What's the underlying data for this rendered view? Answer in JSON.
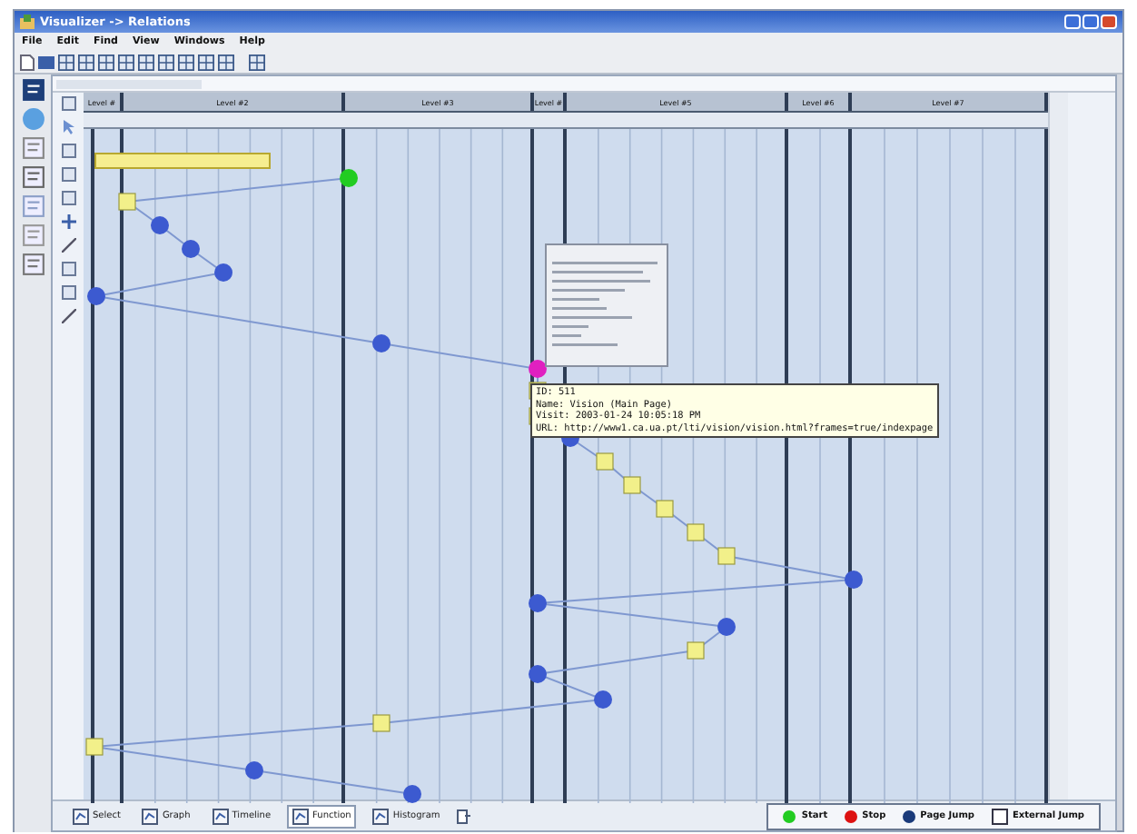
{
  "window": {
    "title": "Visualizer -> Relations"
  },
  "menu": [
    "File",
    "Edit",
    "Find",
    "View",
    "Windows",
    "Help"
  ],
  "levels": [
    "Level #",
    "Level #2",
    "Level #3",
    "Level #",
    "Level #5",
    "Level #6",
    "Level #7"
  ],
  "tooltip": [
    "ID: 511",
    "Name: Vision (Main Page)",
    "Visit: 2003-01-24 10:05:18 PM",
    "URL: http://www1.ca.ua.pt/lti/vision/vision.html?frames=true/indexpage"
  ],
  "view_tabs": [
    {
      "label": "Select",
      "selected": false
    },
    {
      "label": "Graph",
      "selected": false
    },
    {
      "label": "Timeline",
      "selected": false
    },
    {
      "label": "Function",
      "selected": true
    },
    {
      "label": "Histogram",
      "selected": false
    }
  ],
  "legend": [
    {
      "label": "Start",
      "kind": "dot",
      "color": "#22cc22"
    },
    {
      "label": "Stop",
      "kind": "dot",
      "color": "#dd1111"
    },
    {
      "label": "Page Jump",
      "kind": "dot",
      "color": "#1a3a7a"
    },
    {
      "label": "External Jump",
      "kind": "square",
      "color": "#ffffff"
    }
  ]
}
